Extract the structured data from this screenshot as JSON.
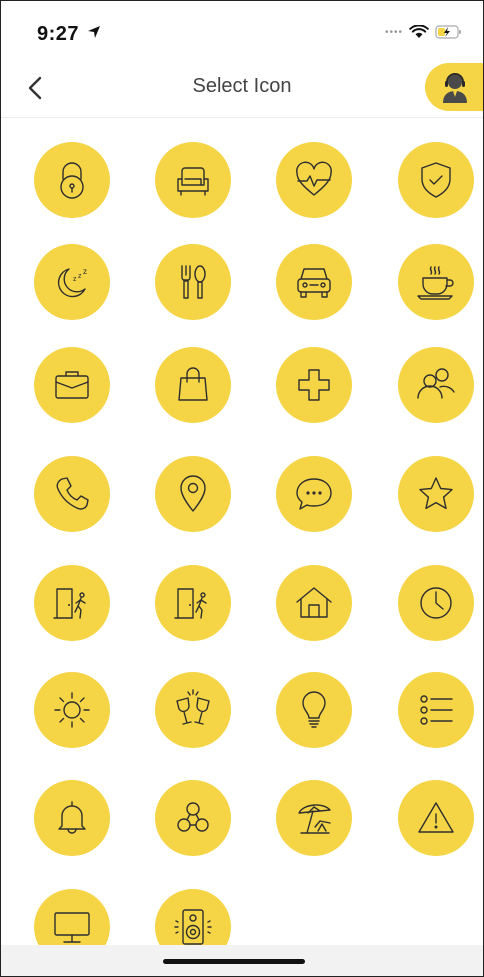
{
  "status_bar": {
    "time": "9:27"
  },
  "nav": {
    "title": "Select Icon",
    "back_icon": "chevron-left-icon",
    "support_icon": "support-agent-icon"
  },
  "colors": {
    "accent": "#f5d546",
    "icon_stroke": "#2e2e2e"
  },
  "icons": [
    "lock-icon",
    "armchair-icon",
    "heart-pulse-icon",
    "shield-check-icon",
    "moon-sleep-icon",
    "fork-spoon-icon",
    "car-icon",
    "coffee-cup-icon",
    "briefcase-icon",
    "shopping-bag-icon",
    "medical-cross-icon",
    "people-icon",
    "phone-icon",
    "location-pin-icon",
    "chat-bubble-icon",
    "star-icon",
    "exit-door-icon",
    "enter-door-icon",
    "home-icon",
    "clock-icon",
    "sun-icon",
    "cheers-glasses-icon",
    "light-bulb-icon",
    "list-icon",
    "bell-icon",
    "network-icon",
    "beach-umbrella-icon",
    "warning-icon",
    "monitor-icon",
    "speaker-icon"
  ]
}
